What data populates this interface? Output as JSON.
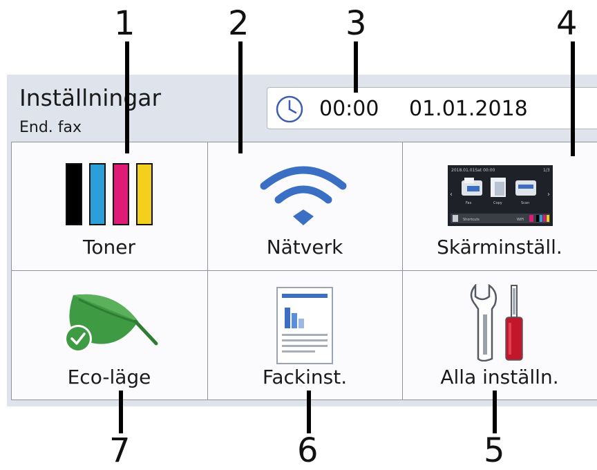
{
  "callouts": [
    "1",
    "2",
    "3",
    "4",
    "7",
    "6",
    "5"
  ],
  "header": {
    "title": "Inställningar",
    "subtitle": "End. fax"
  },
  "clock": {
    "icon": "clock-icon",
    "time": "00:00",
    "date": "01.01.2018"
  },
  "tiles": [
    {
      "label": "Toner",
      "icon": "toner-cartridges-icon",
      "colors": [
        "#000000",
        "#2a9fd8",
        "#e01a77",
        "#f3cf1e"
      ]
    },
    {
      "label": "Nätverk",
      "icon": "wifi-icon",
      "color": "#3a6fc4"
    },
    {
      "label": "Skärminställ.",
      "icon": "screen-preview-icon"
    },
    {
      "label": "Eco-läge",
      "icon": "leaf-icon",
      "colors": [
        "#3f9b43",
        "#5bb15b"
      ]
    },
    {
      "label": "Fackinst.",
      "icon": "tray-document-icon"
    },
    {
      "label": "Alla inställn.",
      "icon": "tools-icon",
      "colors": [
        "#c0182a",
        "#9aa0a8"
      ]
    }
  ],
  "screen_preview": {
    "header_date": "2018.01.01Sat 00:00",
    "page": "1/3",
    "items": [
      "Fax",
      "Copy",
      "Scan"
    ],
    "footer": [
      "Shortcuts",
      "WiFi"
    ]
  }
}
